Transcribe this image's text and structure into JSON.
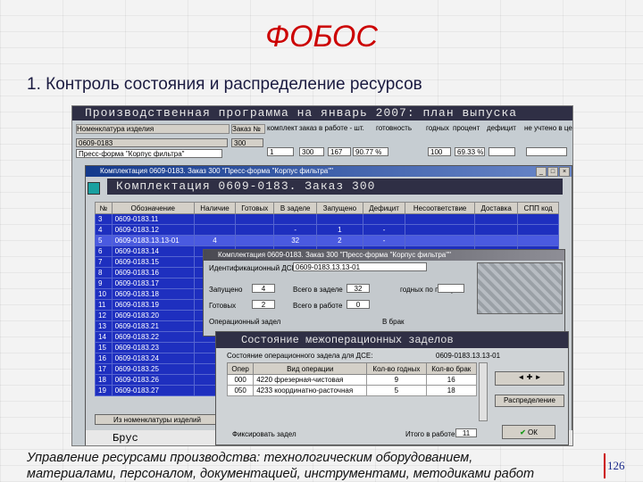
{
  "slide": {
    "title": "ФОБОС",
    "heading": "1. Контроль состояния и распределение ресурсов",
    "caption_line1": "Управление ресурсами производства: технологическим оборудованием,",
    "caption_line2": "материалами, персоналом, документацией, инструментами, методиками работ",
    "page_number": "126"
  },
  "app": {
    "main_title": "Производственная программа на январь 2007: план выпуска",
    "headers": [
      "Номенклатура изделия",
      "Заказ №",
      "комплект",
      "заказ в работе - шт.",
      "готовность",
      "годных",
      "процент",
      "дефицит",
      "не учтено в цехе"
    ],
    "row1": {
      "code": "0609-0183",
      "order": "300",
      "qty": "1",
      "in_work": "300",
      "made": "167",
      "ready": "90.77 %",
      "good": "100",
      "percent": "69.33 %"
    },
    "product": "Пресс-форма \"Корпус фильтра\"",
    "sub_window_title": "Комплектация 0609-0183. Заказ 300 \"Пресс-форма \"Корпус фильтра\"\"",
    "komp_title": "Комплектация 0609-0183. Заказ 300",
    "komp_headers": [
      "№",
      "Обозначение",
      "Наличие",
      "Готовых",
      "В заделе",
      "Запущено",
      "Дефицит",
      "Несоответствие",
      "Доставка",
      "СПП код"
    ],
    "komp_rows": [
      {
        "n": "3",
        "code": "0609-0183.11"
      },
      {
        "n": "4",
        "code": "0609-0183.12",
        "c3": "-",
        "c4": "1",
        "c5": "-"
      },
      {
        "n": "5",
        "code": "0609-0183.13.13-01",
        "c1": "4",
        "c3": "32",
        "c4": "2",
        "c5": "-"
      },
      {
        "n": "6",
        "code": "0609-0183.14"
      },
      {
        "n": "7",
        "code": "0609-0183.15"
      },
      {
        "n": "8",
        "code": "0609-0183.16"
      },
      {
        "n": "9",
        "code": "0609-0183.17"
      },
      {
        "n": "10",
        "code": "0609-0183.18"
      },
      {
        "n": "11",
        "code": "0609-0183.19"
      },
      {
        "n": "12",
        "code": "0609-0183.20"
      },
      {
        "n": "13",
        "code": "0609-0183.21"
      },
      {
        "n": "14",
        "code": "0609-0183.22"
      },
      {
        "n": "15",
        "code": "0609-0183.23"
      },
      {
        "n": "16",
        "code": "0609-0183.24"
      },
      {
        "n": "17",
        "code": "0609-0183.25"
      },
      {
        "n": "18",
        "code": "0609-0183.26"
      },
      {
        "n": "19",
        "code": "0609-0183.27"
      }
    ],
    "bottom_button": "Из номенклатуры изделий",
    "bottom_word": "Брус",
    "detail_title": "Комплектация 0609-0183. Заказ 300 \"Пресс-форма \"Корпус фильтра\"\"",
    "detail_label": "Идентификационный ДСЕ",
    "detail_code": "0609-0183.13.13-01",
    "f_zapusheno_lbl": "Запущено",
    "f_zapusheno_val": "4",
    "f_vzadele_lbl": "Всего в заделе",
    "f_vzadele_val": "32",
    "f_gotovo_lbl": "Готовых",
    "f_gotovo_val": "2",
    "f_vsego_lbl": "Всего в работе",
    "f_vsego_val": "0",
    "f_side_lbl": "годных по плану",
    "op_label": "Операционный задел",
    "op_unit": "В брак",
    "state_title": "Состояние межоперационных заделов",
    "state_sub": "Состояние операционного задела для ДСЕ:",
    "state_code": "0609-0183.13.13-01",
    "op_headers": [
      "Опер",
      "Вид операции",
      "Кол-во годных",
      "Кол-во брак"
    ],
    "op_rows": [
      {
        "op": "000",
        "name": "4220 фрезерная-чистовая",
        "good": "9",
        "bad": "16"
      },
      {
        "op": "050",
        "name": "4233 координатно-расточная",
        "good": "5",
        "bad": "18"
      }
    ],
    "distrib_button": "Распределение",
    "fix_label": "Фиксировать задел",
    "itogo_label": "Итого в работе",
    "itogo_val": "11",
    "ok_label": "ОК"
  }
}
